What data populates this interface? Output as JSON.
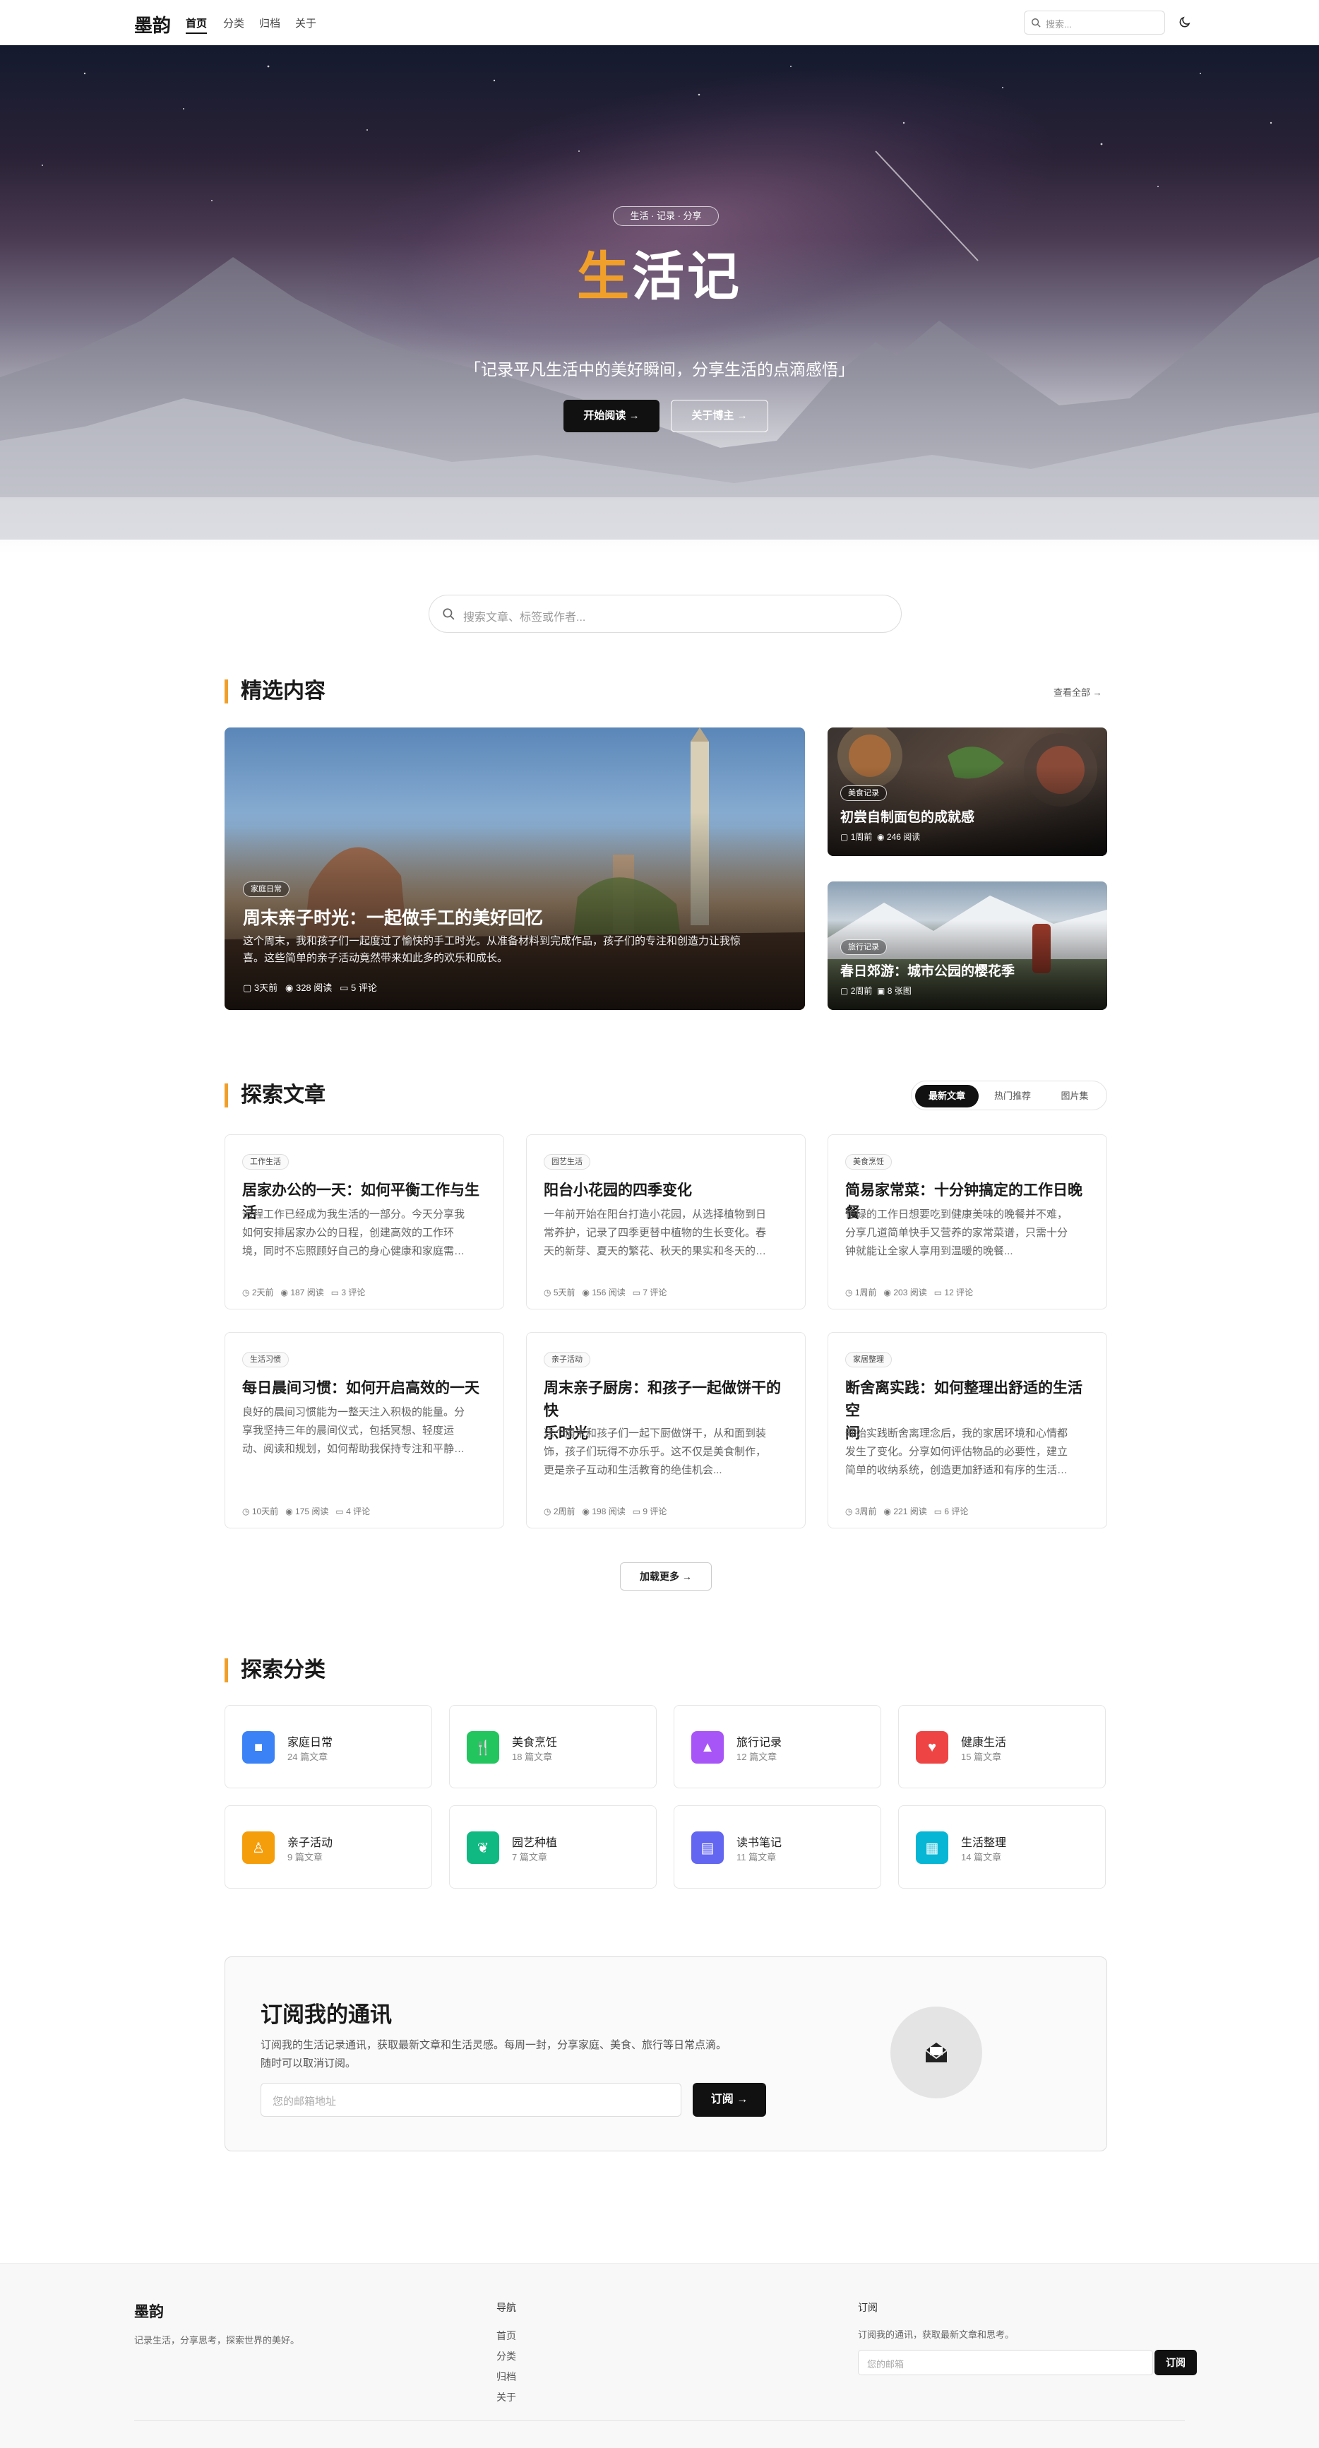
{
  "nav": {
    "brand": "墨韵",
    "links": [
      "首页",
      "分类",
      "归档",
      "关于"
    ],
    "search_placeholder": "搜索..."
  },
  "hero": {
    "pill": "生活 · 记录 · 分享",
    "title_first": "生",
    "title_rest": "活记",
    "subtitle": "「记录平凡生活中的美好瞬间，分享生活的点滴感悟」",
    "btn_primary": "开始阅读",
    "btn_secondary": "关于博主"
  },
  "search": {
    "placeholder": "搜索文章、标签或作者..."
  },
  "featured": {
    "heading": "精选内容",
    "view_all": "查看全部",
    "main": {
      "tag": "家庭日常",
      "title": "周末亲子时光：一起做手工的美好回忆",
      "desc_line1": "这个周末，我和孩子们一起度过了愉快的手工时光。从准备材料到完成作品，孩子们的专注和创造力让我惊",
      "desc_line2": "喜。这些简单的亲子活动竟然带来如此多的欢乐和成长。",
      "time": "3天前",
      "views": "328 阅读",
      "comments": "5 评论"
    },
    "side": [
      {
        "tag": "美食记录",
        "title": "初尝自制面包的成就感",
        "time": "1周前",
        "views": "246 阅读"
      },
      {
        "tag": "旅行记录",
        "title": "春日郊游：城市公园的樱花季",
        "time": "2周前",
        "views": "8 张图"
      }
    ]
  },
  "explore": {
    "heading": "探索文章",
    "tabs": [
      "最新文章",
      "热门推荐",
      "图片集"
    ],
    "articles": [
      {
        "tag": "工作生活",
        "title_l1": "居家办公的一天：如何平衡工作与生活",
        "title_l2": "",
        "desc": [
          "远程工作已经成为我生活的一部分。今天分享我",
          "如何安排居家办公的日程，创建高效的工作环",
          "境，同时不忘照顾好自己的身心健康和家庭需…"
        ],
        "time": "2天前",
        "views": "187 阅读",
        "comments": "3 评论"
      },
      {
        "tag": "园艺生活",
        "title_l1": "阳台小花园的四季变化",
        "title_l2": "",
        "desc": [
          "一年前开始在阳台打造小花园，从选择植物到日",
          "常养护，记录了四季更替中植物的生长变化。春",
          "天的新芽、夏天的繁花、秋天的果实和冬天的…"
        ],
        "time": "5天前",
        "views": "156 阅读",
        "comments": "7 评论"
      },
      {
        "tag": "美食烹饪",
        "title_l1": "简易家常菜：十分钟搞定的工作日晚餐",
        "title_l2": "",
        "desc": [
          "忙碌的工作日想要吃到健康美味的晚餐并不难，",
          "分享几道简单快手又营养的家常菜谱，只需十分",
          "钟就能让全家人享用到温暖的晚餐..."
        ],
        "time": "1周前",
        "views": "203 阅读",
        "comments": "12 评论"
      },
      {
        "tag": "生活习惯",
        "title_l1": "每日晨间习惯：如何开启高效的一天",
        "title_l2": "",
        "desc": [
          "良好的晨间习惯能为一整天注入积极的能量。分",
          "享我坚持三年的晨间仪式，包括冥想、轻度运",
          "动、阅读和规划，如何帮助我保持专注和平静…"
        ],
        "time": "10天前",
        "views": "175 阅读",
        "comments": "4 评论"
      },
      {
        "tag": "亲子活动",
        "title_l1": "周末亲子厨房：和孩子一起做饼干的快",
        "title_l2": "乐时光",
        "desc": [
          "这个周末和孩子们一起下厨做饼干，从和面到装",
          "饰，孩子们玩得不亦乐乎。这不仅是美食制作，",
          "更是亲子互动和生活教育的绝佳机会..."
        ],
        "time": "2周前",
        "views": "198 阅读",
        "comments": "9 评论"
      },
      {
        "tag": "家居整理",
        "title_l1": "断舍离实践：如何整理出舒适的生活空",
        "title_l2": "间",
        "desc": [
          "开始实践断舍离理念后，我的家居环境和心情都",
          "发生了变化。分享如何评估物品的必要性，建立",
          "简单的收纳系统，创造更加舒适和有序的生活…"
        ],
        "time": "3周前",
        "views": "221 阅读",
        "comments": "6 评论"
      }
    ],
    "load_more": "加载更多"
  },
  "categories": {
    "heading": "探索分类",
    "items": [
      {
        "name": "家庭日常",
        "count": "24 篇文章",
        "color": "#3b82f6",
        "icon": "home-icon"
      },
      {
        "name": "美食烹饪",
        "count": "18 篇文章",
        "color": "#22c55e",
        "icon": "utensils-icon"
      },
      {
        "name": "旅行记录",
        "count": "12 篇文章",
        "color": "#a855f7",
        "icon": "image-icon"
      },
      {
        "name": "健康生活",
        "count": "15 篇文章",
        "color": "#ef4444",
        "icon": "heart-pulse-icon"
      },
      {
        "name": "亲子活动",
        "count": "9 篇文章",
        "color": "#f59e0b",
        "icon": "child-icon"
      },
      {
        "name": "园艺种植",
        "count": "7 篇文章",
        "color": "#10b981",
        "icon": "seedling-icon"
      },
      {
        "name": "读书笔记",
        "count": "11 篇文章",
        "color": "#6366f1",
        "icon": "book-icon"
      },
      {
        "name": "生活整理",
        "count": "14 篇文章",
        "color": "#06b6d4",
        "icon": "box-icon"
      }
    ]
  },
  "subscribe": {
    "title": "订阅我的通讯",
    "desc_line1": "订阅我的生活记录通讯，获取最新文章和生活灵感。每周一封，分享家庭、美食、旅行等日常点滴。",
    "desc_line2": "随时可以取消订阅。",
    "placeholder": "您的邮箱地址",
    "button": "订阅"
  },
  "footer": {
    "brand": "墨韵",
    "tagline": "记录生活，分享思考，探索世界的美好。",
    "nav_heading": "导航",
    "nav_links": [
      "首页",
      "分类",
      "归档",
      "关于"
    ],
    "sub_heading": "订阅",
    "sub_text": "订阅我的通讯，获取最新文章和思考。",
    "sub_placeholder": "您的邮箱",
    "sub_button": "订阅"
  }
}
